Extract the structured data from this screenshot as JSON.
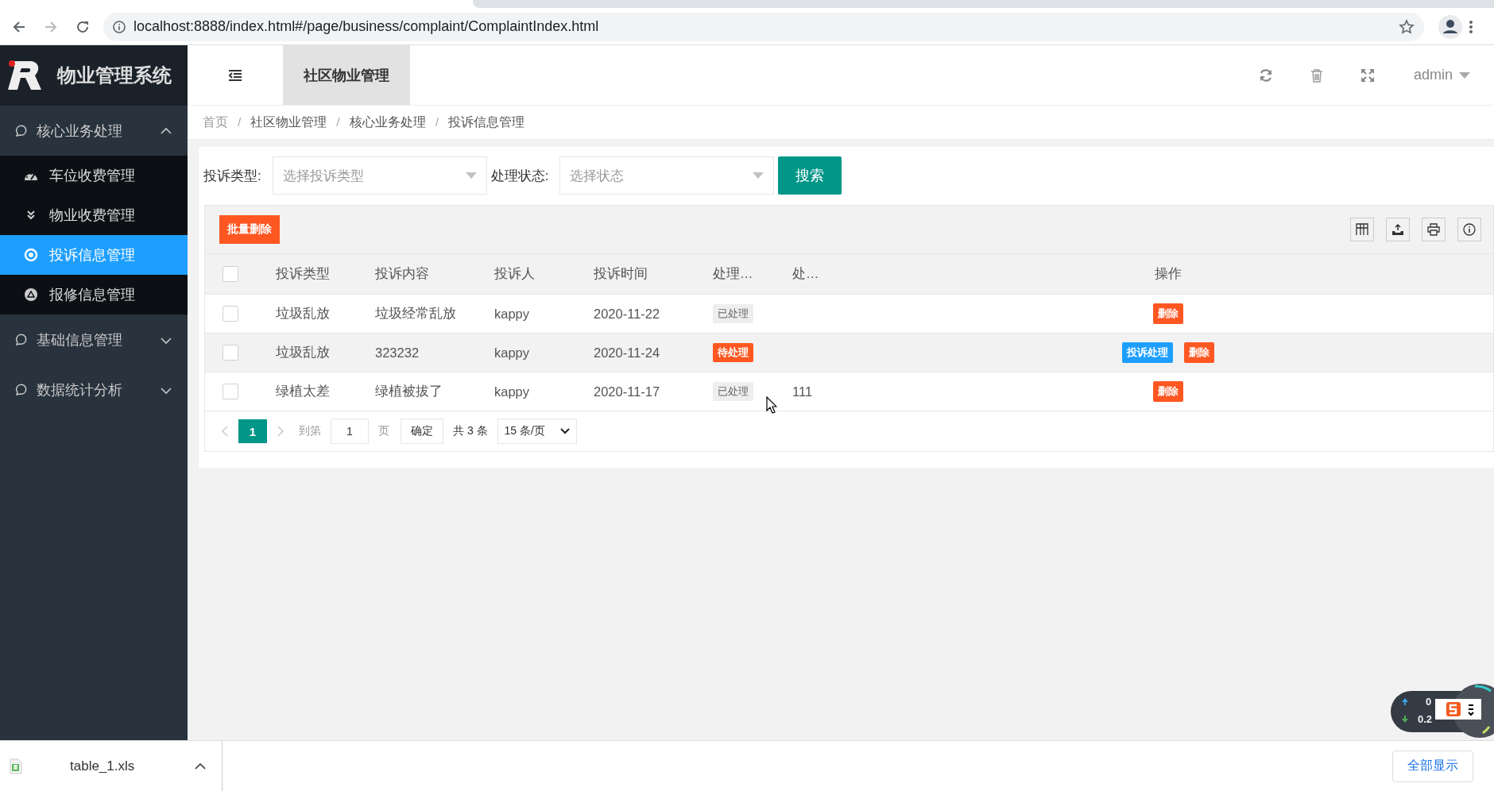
{
  "browser": {
    "url": "localhost:8888/index.html#/page/business/complaint/ComplaintIndex.html"
  },
  "sidebar": {
    "title": "物业管理系统",
    "groups": [
      {
        "label": "核心业务处理",
        "expanded": true,
        "children": [
          {
            "label": "车位收费管理",
            "selected": false
          },
          {
            "label": "物业收费管理",
            "selected": false
          },
          {
            "label": "投诉信息管理",
            "selected": true
          },
          {
            "label": "报修信息管理",
            "selected": false
          }
        ]
      },
      {
        "label": "基础信息管理",
        "expanded": false
      },
      {
        "label": "数据统计分析",
        "expanded": false
      }
    ]
  },
  "header": {
    "tabs": [
      {
        "label": "社区物业管理",
        "selected": true
      }
    ],
    "user": "admin"
  },
  "breadcrumb": [
    {
      "label": "首页"
    },
    {
      "separator": "/",
      "label": "社区物业管理"
    },
    {
      "separator": "/",
      "label": "核心业务处理"
    },
    {
      "separator": "/",
      "label": "投诉信息管理"
    }
  ],
  "filters": [
    {
      "label": "投诉类型:",
      "placeholder": "选择投诉类型"
    },
    {
      "label": "处理状态:",
      "placeholder": "选择状态"
    }
  ],
  "search_button": "搜索",
  "toolbar": {
    "batch_delete": "批量删除"
  },
  "table": {
    "header_checked": false,
    "columns": [
      "投诉类型",
      "投诉内容",
      "投诉人",
      "投诉时间",
      "处理…",
      "处…",
      "操作"
    ],
    "rows": [
      {
        "checked": false,
        "type": "垃圾乱放",
        "content": "垃圾经常乱放",
        "person": "kappy",
        "time": "2020-11-22",
        "status": {
          "label": "已处理",
          "kind": "done"
        },
        "actions": [
          {
            "label": "删除",
            "kind": "delete"
          }
        ]
      },
      {
        "checked": false,
        "type": "垃圾乱放",
        "content": "323232",
        "person": "kappy",
        "time": "2020-11-24",
        "status": {
          "label": "待处理",
          "kind": "pending"
        },
        "actions": [
          {
            "label": "投诉处理",
            "kind": "handle"
          },
          {
            "label": "删除",
            "kind": "delete"
          }
        ]
      },
      {
        "checked": false,
        "type": "绿植太差",
        "content": "绿植被拔了",
        "person": "kappy",
        "time": "2020-11-17",
        "status": {
          "label": "已处理",
          "kind": "done"
        },
        "result": "111",
        "actions": [
          {
            "label": "删除",
            "kind": "delete"
          }
        ]
      }
    ]
  },
  "pagination": {
    "pages": [
      {
        "label": "1",
        "selected": true
      }
    ],
    "goto_label": "到第",
    "goto_value": "1",
    "page_unit": "页",
    "confirm": "确定",
    "total": "共 3 条",
    "page_size": "15 条/页"
  },
  "downloads": {
    "file": "table_1.xls",
    "show_all": "全部显示"
  },
  "net_widget": {
    "up": "0",
    "down": "0.2"
  }
}
